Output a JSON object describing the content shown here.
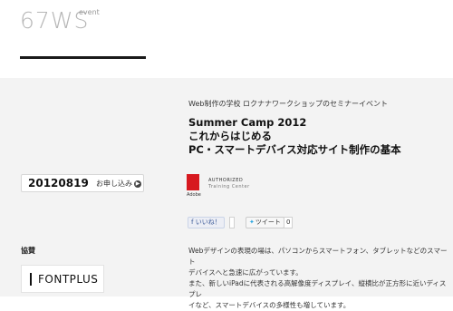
{
  "header": {
    "logo_text": "67WS",
    "logo_sup": "event"
  },
  "event": {
    "subtitle": "Web制作の学校 ロクナナワークショップのセミナーイベント",
    "title_line1": "Summer Camp 2012",
    "title_line2": "これからはじめる",
    "title_line3": "PC・スマートデバイス対応サイト制作の基本",
    "date": "20120819",
    "apply_label": "お申し込み"
  },
  "adobe": {
    "brand": "Adobe",
    "authorized": "AUTHORIZED",
    "training_center": "Training Center"
  },
  "social": {
    "like_label": "いいね！",
    "like_count": "",
    "tweet_label": "ツイート",
    "tweet_count": "0"
  },
  "sponsor": {
    "label": "協賛",
    "fontplus_text": "FONTPLUS"
  },
  "description": {
    "line1": "Webデザインの表現の場は、パソコンからスマートフォン、タブレットなどのスマート",
    "line2": "デバイスへと急速に広がっています。",
    "line3": "また、新しいiPadに代表される高解像度ディスプレイ、縦横比が正方形に近いディスプレ",
    "line4": "イなど、スマートデバイスの多様性も増しています。"
  },
  "colors": {
    "background": "#f3f3f3",
    "logo_gray": "#b6b6b6",
    "adobe_red": "#d7191f",
    "facebook_blue": "#3b5998"
  }
}
